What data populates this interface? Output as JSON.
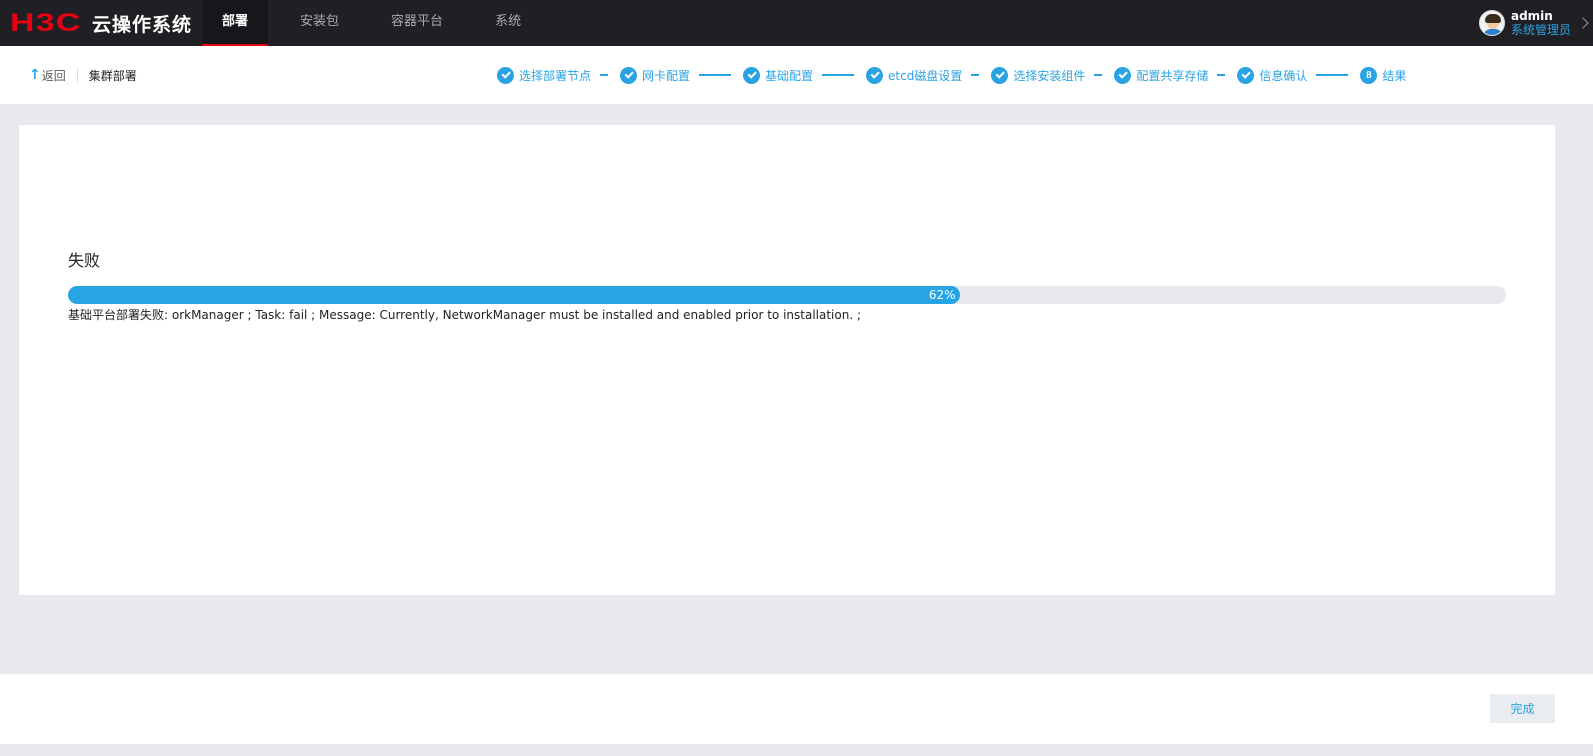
{
  "header": {
    "logo": "H3C",
    "product": "云操作系统",
    "nav": [
      {
        "label": "部署",
        "active": true
      },
      {
        "label": "安装包",
        "active": false
      },
      {
        "label": "容器平台",
        "active": false
      },
      {
        "label": "系统",
        "active": false
      }
    ],
    "user": {
      "name": "admin",
      "role": "系统管理员",
      "avatar_icon": "user-avatar-icon"
    }
  },
  "subheader": {
    "back_label": "返回",
    "title": "集群部署",
    "steps": [
      {
        "label": "选择部署节点",
        "status": "done"
      },
      {
        "label": "网卡配置",
        "status": "done"
      },
      {
        "label": "基础配置",
        "status": "done"
      },
      {
        "label": "etcd磁盘设置",
        "status": "done"
      },
      {
        "label": "选择安装组件",
        "status": "done"
      },
      {
        "label": "配置共享存储",
        "status": "done"
      },
      {
        "label": "信息确认",
        "status": "done"
      },
      {
        "label": "结果",
        "number": "8",
        "status": "current"
      }
    ]
  },
  "result": {
    "status": "失败",
    "progress": 62,
    "progress_label": "62%",
    "message": "基础平台部署失败: orkManager ; Task: fail ; Message: Currently, NetworkManager must be installed and enabled prior to installation. ;"
  },
  "footer": {
    "finish_label": "完成"
  },
  "colors": {
    "accent": "#2aa3e5",
    "brand_red": "#e60012",
    "topbar": "#201f24"
  }
}
